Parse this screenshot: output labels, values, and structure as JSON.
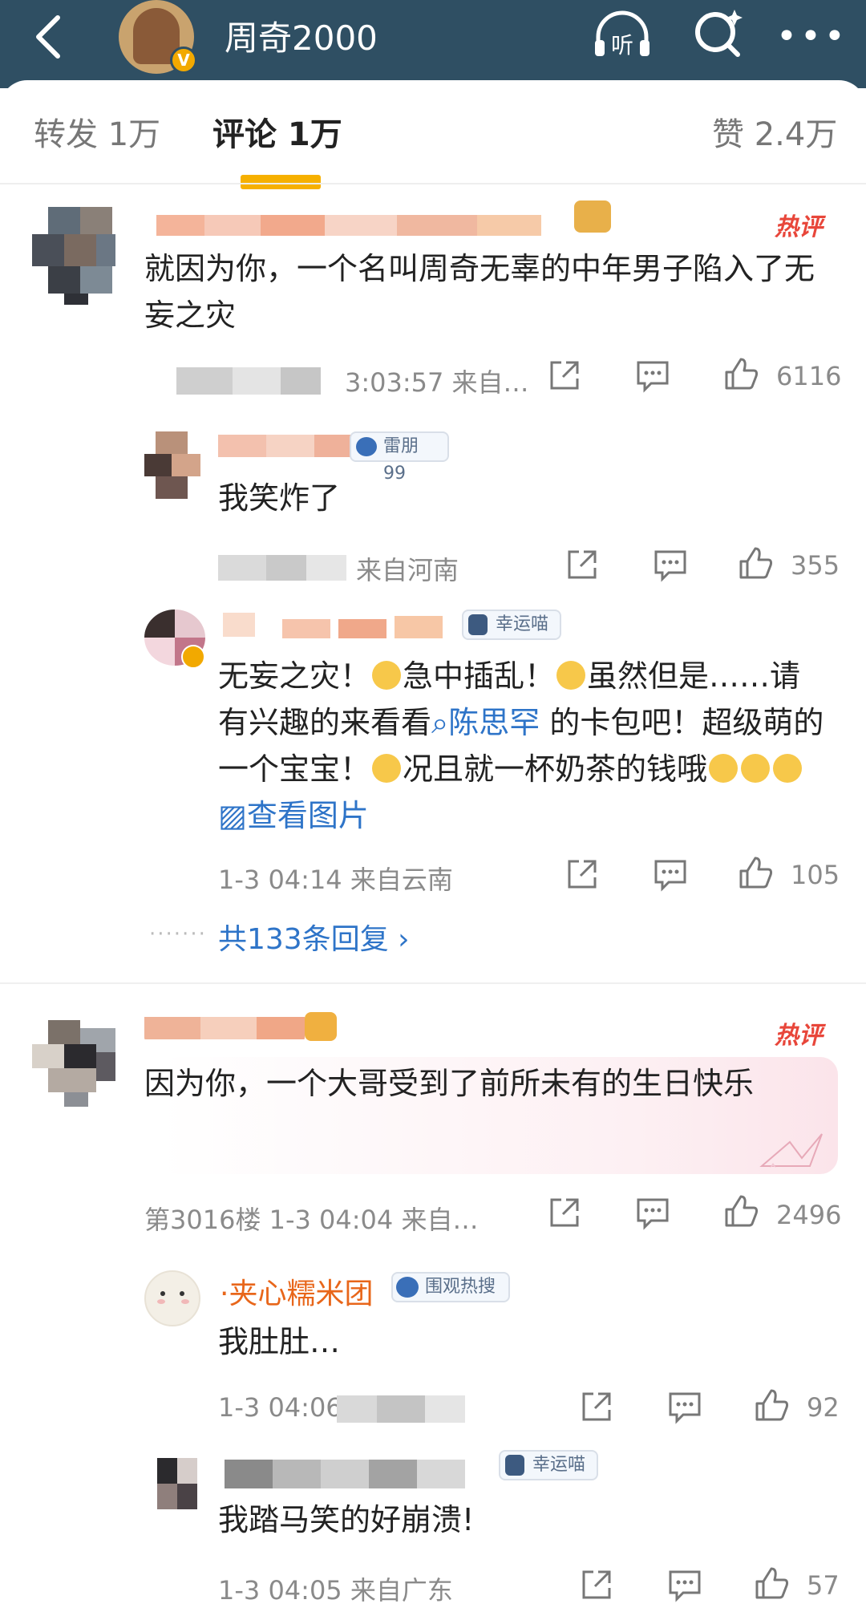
{
  "header": {
    "title": "周奇2000",
    "verified_badge": "V",
    "icons": [
      "back-icon",
      "listen-icon",
      "search-icon",
      "more-icon"
    ],
    "listen_label": "听"
  },
  "tabs": [
    {
      "label": "转发 1万",
      "active": false
    },
    {
      "label": "评论 1万",
      "active": true
    },
    {
      "label": "赞 2.4万",
      "active": false
    }
  ],
  "colors": {
    "topbar": "#2f4f63",
    "accent": "#f6b000",
    "hot": "#e8463a",
    "link": "#2e74c8"
  },
  "comments": [
    {
      "hot_label": "热评",
      "text": "就因为你，一个名叫周奇无辜的中年男子陷入了无妄之灾",
      "meta": "3:03:57 来自…",
      "likes": "6116",
      "replies": [
        {
          "badge": "雷朋99",
          "text": "我笑炸了",
          "meta": "来自河南",
          "likes": "355"
        },
        {
          "badge": "幸运喵",
          "text_parts": {
            "a": "无妄之灾！",
            "b": "急中插乱！",
            "c": "虽然但是……请有兴趣的来看看",
            "link_search": "陈思罕",
            "d": "的卡包吧！超级萌的一个宝宝！",
            "e": "况且就一杯奶茶的钱哦",
            "link_image": "查看图片"
          },
          "meta": "1-3 04:14 来自云南",
          "likes": "105"
        }
      ],
      "more_replies": "共133条回复"
    },
    {
      "hot_label": "热评",
      "text": "因为你，一个大哥受到了前所未有的生日快乐",
      "meta": "第3016楼 1-3 04:04 来自…",
      "likes": "2496",
      "replies": [
        {
          "name": "·夹心糯米团",
          "badge": "围观热搜",
          "text": "我肚肚…",
          "meta": "1-3 04:06",
          "likes": "92"
        },
        {
          "badge": "幸运喵",
          "text": "我踏马笑的好崩溃!",
          "meta": "1-3 04:05 来自广东",
          "likes": "57"
        }
      ]
    }
  ]
}
